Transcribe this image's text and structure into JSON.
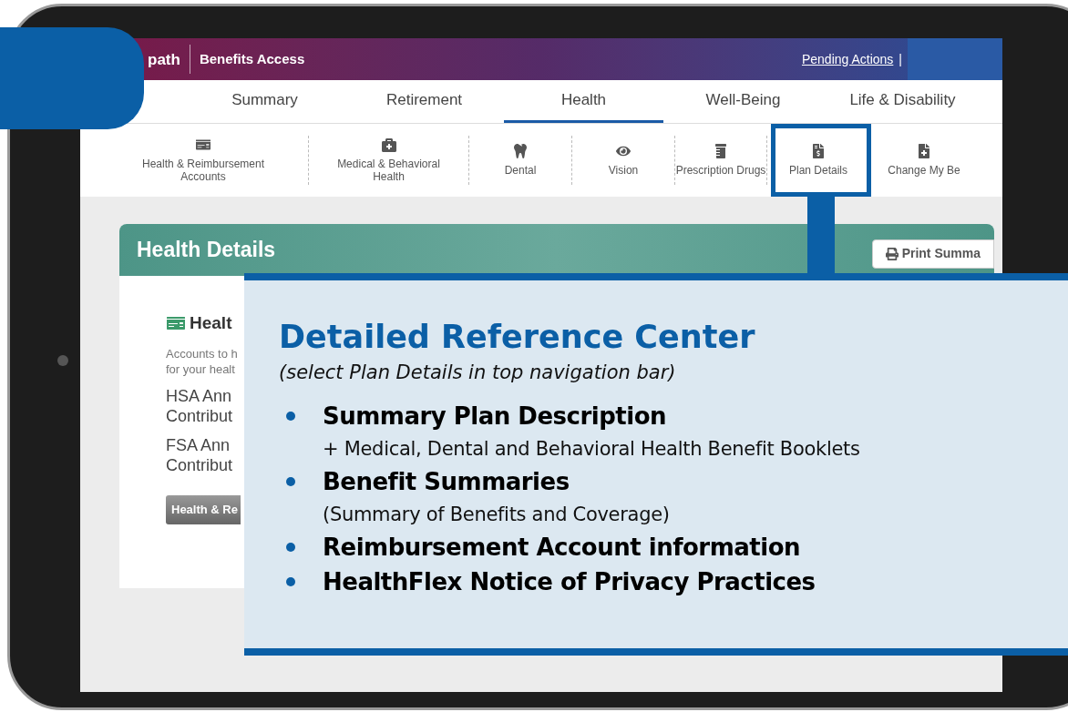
{
  "header": {
    "logo": "path",
    "title": "Benefits Access",
    "pending_actions": "Pending Actions",
    "separator": "|"
  },
  "tabs": [
    {
      "label": "Summary",
      "selected": false
    },
    {
      "label": "Retirement",
      "selected": false
    },
    {
      "label": "Health",
      "selected": true
    },
    {
      "label": "Well-Being",
      "selected": false
    },
    {
      "label": "Life & Disability",
      "selected": false
    }
  ],
  "subnav": [
    {
      "kind": "accounts",
      "lines": [
        "Health & Reimbursement",
        "Accounts"
      ]
    },
    {
      "kind": "medical",
      "lines": [
        "Medical & Behavioral",
        "Health"
      ]
    },
    {
      "kind": "dental",
      "lines": [
        "Dental"
      ]
    },
    {
      "kind": "vision",
      "lines": [
        "Vision"
      ]
    },
    {
      "kind": "prescription",
      "lines": [
        "Prescription Drugs"
      ]
    },
    {
      "kind": "plan",
      "lines": [
        "Plan Details"
      ]
    },
    {
      "kind": "change",
      "lines": [
        "Change My Be"
      ]
    }
  ],
  "card": {
    "title": "Health Details",
    "print_button": "Print Summa",
    "section_title": "Healt",
    "description": [
      "Accounts to h",
      "for your healt"
    ],
    "fields": [
      [
        "HSA Ann",
        "Contribut"
      ],
      [
        "FSA Ann",
        "Contribut"
      ]
    ],
    "button": "Health & Re"
  },
  "callout": {
    "title": "Detailed Reference Center",
    "subtitle": "(select Plan Details in top navigation bar)",
    "bullets": [
      {
        "text": "Summary Plan Description",
        "note": "+  Medical, Dental and Behavioral Health Benefit Booklets"
      },
      {
        "text": "Benefit Summaries",
        "note": "(Summary of Benefits and Coverage)"
      },
      {
        "text": "Reimbursement Account information"
      },
      {
        "text": "HealthFlex Notice of Privacy Practices"
      }
    ]
  }
}
